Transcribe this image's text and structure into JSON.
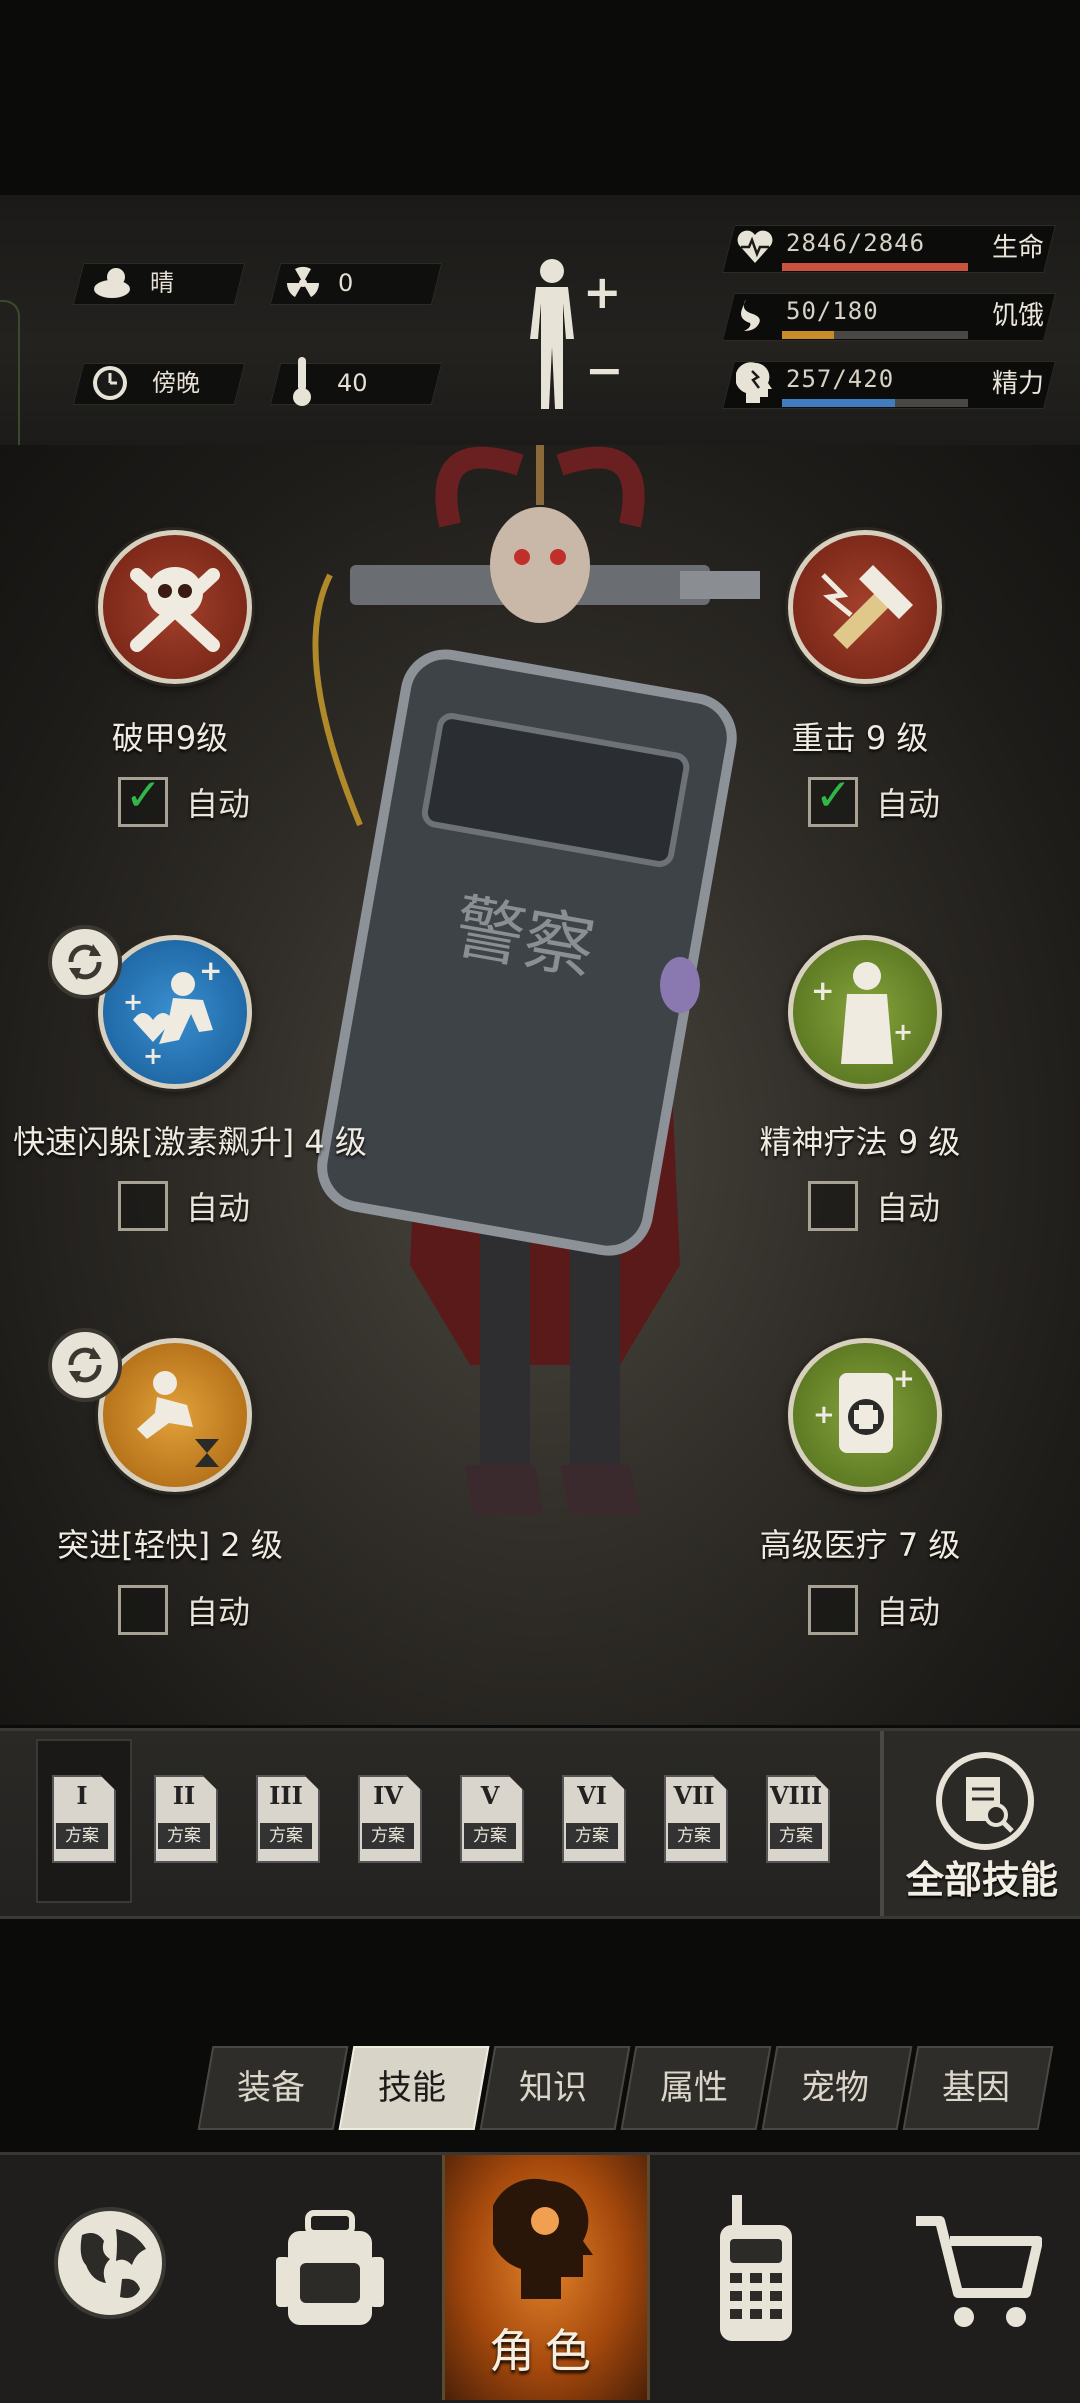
{
  "status": {
    "weather": "晴",
    "radiation": "0",
    "time_of_day": "傍晚",
    "temperature": "40"
  },
  "vitals": [
    {
      "label": "生命",
      "value": "2846/2846",
      "fraction": 1.0,
      "color": "#c9533e",
      "icon": "heart-pulse-icon"
    },
    {
      "label": "饥饿",
      "value": "50/180",
      "fraction": 0.28,
      "color": "#c98c2a",
      "icon": "stomach-icon"
    },
    {
      "label": "精力",
      "value": "257/420",
      "fraction": 0.61,
      "color": "#3f7cc0",
      "icon": "brain-head-icon"
    }
  ],
  "skills": [
    {
      "label": "破甲9级",
      "auto": true,
      "icon": "skull-crossbones-icon",
      "bg": "#8a2a1a"
    },
    {
      "label": "重击 9 级",
      "auto": true,
      "icon": "smash-icon",
      "bg": "#8a2a1a"
    },
    {
      "label": "快速闪躲[激素飙升] 4 级",
      "auto": false,
      "icon": "dodge-icon",
      "bg": "#1d6fb0",
      "swap": true
    },
    {
      "label": "精神疗法 9 级",
      "auto": false,
      "icon": "mind-heal-icon",
      "bg": "#5d7a26"
    },
    {
      "label": "突进[轻快] 2 级",
      "auto": false,
      "icon": "dash-icon",
      "bg": "#c07a14",
      "swap": true
    },
    {
      "label": "高级医疗 7 级",
      "auto": false,
      "icon": "medkit-icon",
      "bg": "#5d7a26"
    }
  ],
  "auto_label": "自动",
  "plans": [
    {
      "num": "I",
      "word": "方案"
    },
    {
      "num": "II",
      "word": "方案"
    },
    {
      "num": "III",
      "word": "方案"
    },
    {
      "num": "IV",
      "word": "方案"
    },
    {
      "num": "V",
      "word": "方案"
    },
    {
      "num": "VI",
      "word": "方案"
    },
    {
      "num": "VII",
      "word": "方案"
    },
    {
      "num": "VIII",
      "word": "方案"
    }
  ],
  "all_skills_label": "全部技能",
  "tabs": [
    "装备",
    "技能",
    "知识",
    "属性",
    "宠物",
    "基因"
  ],
  "active_tab": "技能",
  "nav": {
    "character_label": "角色"
  },
  "shield_text": "警察"
}
